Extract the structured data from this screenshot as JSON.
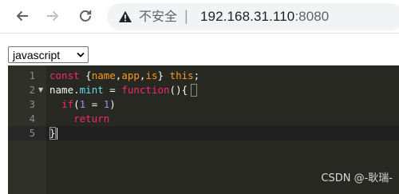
{
  "browser": {
    "security_label": "不安全",
    "separator": "|",
    "url_host": "192.168.31.110",
    "url_port": ":8080",
    "icons": [
      "back-arrow-icon",
      "forward-arrow-icon",
      "reload-icon",
      "warning-triangle-icon"
    ]
  },
  "editor": {
    "language": "javascript",
    "line_numbers": [
      "1",
      "2",
      "3",
      "4",
      "5"
    ],
    "lines": [
      [
        {
          "t": "const ",
          "c": "kw"
        },
        {
          "t": "{",
          "c": "plain"
        },
        {
          "t": "name",
          "c": "var"
        },
        {
          "t": ",",
          "c": "plain"
        },
        {
          "t": "app",
          "c": "var"
        },
        {
          "t": ",",
          "c": "plain"
        },
        {
          "t": "is",
          "c": "var"
        },
        {
          "t": "} ",
          "c": "plain"
        },
        {
          "t": "this",
          "c": "var"
        },
        {
          "t": ";",
          "c": "plain"
        }
      ],
      [
        {
          "t": "name",
          "c": "plain"
        },
        {
          "t": ".",
          "c": "plain"
        },
        {
          "t": "mint",
          "c": "fn"
        },
        {
          "t": " = ",
          "c": "plain"
        },
        {
          "t": "function",
          "c": "kw"
        },
        {
          "t": "(){",
          "c": "plain"
        }
      ],
      [
        {
          "t": "  ",
          "c": "plain"
        },
        {
          "t": "if",
          "c": "kw"
        },
        {
          "t": "(",
          "c": "plain"
        },
        {
          "t": "1",
          "c": "num"
        },
        {
          "t": " = ",
          "c": "plain"
        },
        {
          "t": "1",
          "c": "num"
        },
        {
          "t": ")",
          "c": "plain"
        }
      ],
      [
        {
          "t": "    ",
          "c": "plain"
        },
        {
          "t": "return",
          "c": "kw"
        }
      ],
      [
        {
          "t": "}",
          "c": "plain"
        }
      ]
    ],
    "colors": {
      "background": "#272822",
      "gutter": "#2f3129",
      "keyword": "#f92672",
      "variable": "#fd971f",
      "function": "#66d9ef",
      "number": "#ae81ff",
      "text": "#f8f8f2"
    }
  },
  "watermark": "CSDN @-耿瑞-"
}
